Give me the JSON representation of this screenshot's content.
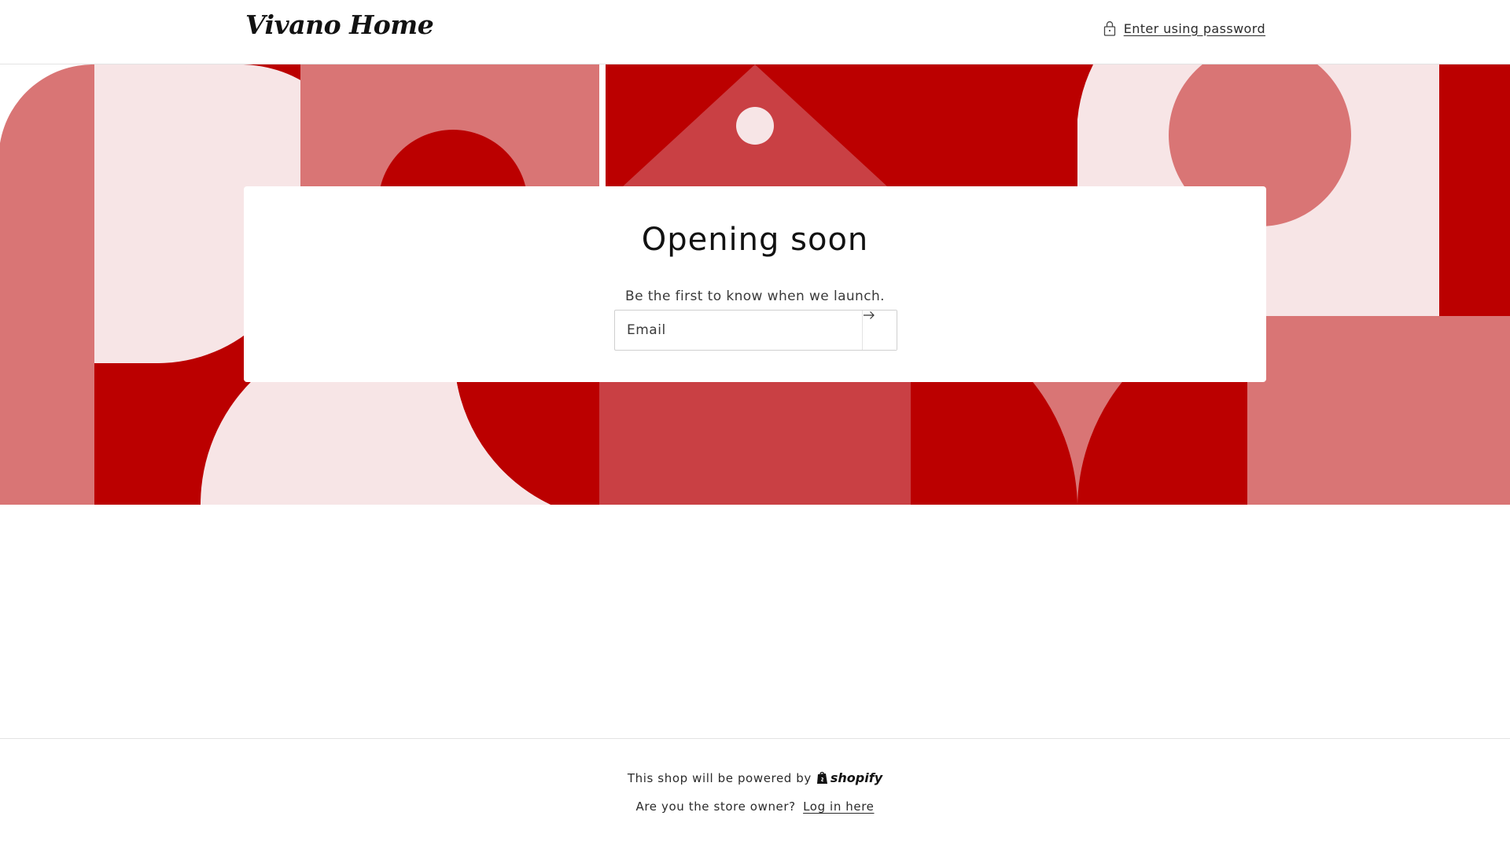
{
  "header": {
    "logo_text": "Vivano Home",
    "password_link": "Enter using password"
  },
  "hero": {
    "title": "Opening soon",
    "subtitle": "Be the first to know when we launch.",
    "email_placeholder": "Email",
    "submit_icon": "arrow-right-icon"
  },
  "footer": {
    "powered_text": "This shop will be powered by",
    "shopify_text": "shopify",
    "owner_text": "Are you the store owner?",
    "login_link": "Log in here"
  },
  "colors": {
    "red_dark": "#bb0000",
    "red_mid": "#c94044",
    "red_light": "#d97575",
    "pink_pale": "#f7e5e6"
  },
  "icons": {
    "lock": "lock-icon",
    "arrow": "arrow-right-icon",
    "shopify": "shopify-bag-icon"
  }
}
